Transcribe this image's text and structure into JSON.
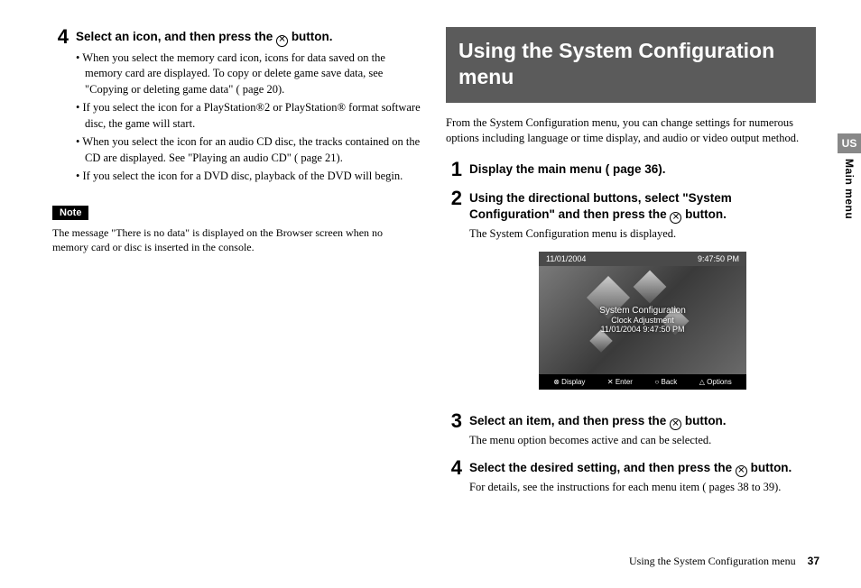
{
  "side": {
    "region": "US",
    "section": "Main menu"
  },
  "footer": {
    "title": "Using the System Configuration menu",
    "page": "37"
  },
  "left": {
    "step4": {
      "num": "4",
      "title_a": "Select an icon, and then press the ",
      "title_b": " button.",
      "bullets": [
        "When you select the memory card icon, icons for data saved on the memory card are displayed. To copy or delete game save data, see \"Copying or deleting game data\" ( page 20).",
        "If you select the icon for a PlayStation®2 or PlayStation® format software disc, the game will start.",
        "When you select the icon for an audio CD disc, the tracks contained on the CD are displayed. See \"Playing an audio CD\" ( page 21).",
        "If you select the icon for a DVD disc, playback of the DVD will begin."
      ]
    },
    "note": {
      "label": "Note",
      "text": "The message \"There is no data\" is displayed on the Browser screen when no memory card or disc is inserted in the console."
    }
  },
  "right": {
    "header": "Using the System Configuration menu",
    "intro": "From the System Configuration menu, you can change settings for numerous options including language or time display, and audio or video output method.",
    "step1": {
      "num": "1",
      "title": "Display the main menu ( page 36)."
    },
    "step2": {
      "num": "2",
      "title_a": "Using the directional buttons, select \"System Configuration\" and then press the ",
      "title_b": " button.",
      "body": "The System Configuration menu is displayed."
    },
    "screenshot": {
      "date": "11/01/2004",
      "time": "9:47:50 PM",
      "line1": "System Configuration",
      "line2": "Clock Adjustment",
      "line3": "11/01/2004    9:47:50 PM",
      "b1": "⊗ Display",
      "b2": "✕ Enter",
      "b3": "○ Back",
      "b4": "△ Options"
    },
    "step3": {
      "num": "3",
      "title_a": "Select an item, and then press the ",
      "title_b": " button.",
      "body": "The menu option becomes active and can be selected."
    },
    "step4": {
      "num": "4",
      "title_a": "Select the desired setting, and then press the ",
      "title_b": " button.",
      "body": "For details, see the instructions for each menu item ( pages 38 to 39)."
    }
  }
}
